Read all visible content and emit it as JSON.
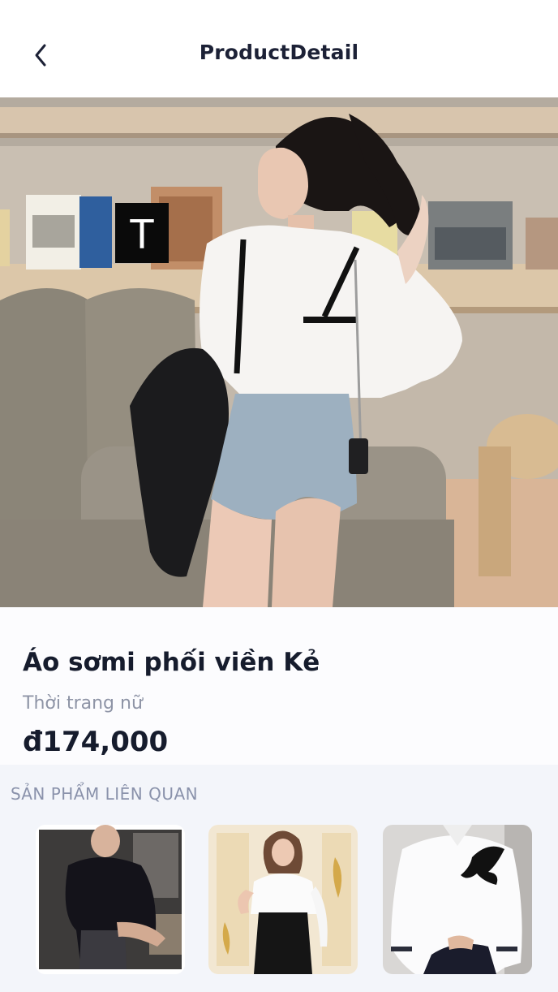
{
  "header": {
    "title": "ProductDetail",
    "back_icon": "chevron-left-icon"
  },
  "hero": {
    "sign_letter": "T"
  },
  "product": {
    "name": "Áo sơmi phối viền Kẻ",
    "category": "Thời trang nữ",
    "price": "đ174,000"
  },
  "related": {
    "title": "SẢN PHẨM LIÊN QUAN",
    "items": [
      {
        "description": "black-shirt-man"
      },
      {
        "description": "white-blouse-woman"
      },
      {
        "description": "white-eagle-shirt-man"
      }
    ]
  },
  "colors": {
    "text_primary": "#161c2d",
    "text_secondary": "#8e94a6",
    "related_bg": "#f3f5fa"
  }
}
